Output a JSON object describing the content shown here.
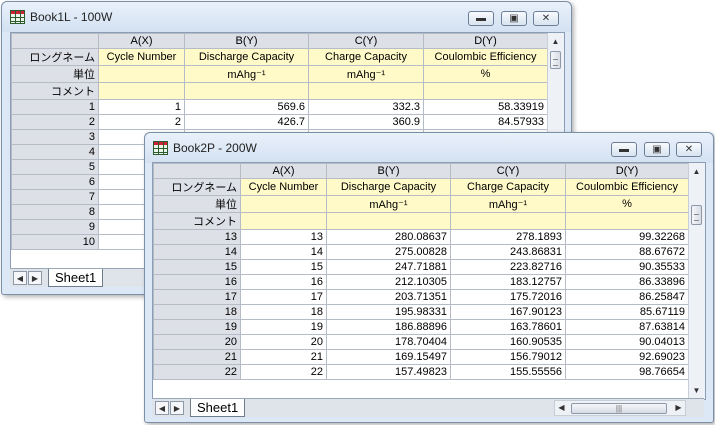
{
  "window1": {
    "title": "Book1L - 100W",
    "columns": [
      "A(X)",
      "B(Y)",
      "C(Y)",
      "D(Y)"
    ],
    "long_name_label": "ロングネーム",
    "units_label": "単位",
    "comment_label": "コメント",
    "long_names": [
      "Cycle Number",
      "Discharge Capacity",
      "Charge Capacity",
      "Coulombic Efficiency"
    ],
    "units": [
      "",
      "mAhg⁻¹",
      "mAhg⁻¹",
      "%"
    ],
    "rows": [
      {
        "idx": "1",
        "a": "1",
        "b": "569.6",
        "c": "332.3",
        "d": "58.33919"
      },
      {
        "idx": "2",
        "a": "2",
        "b": "426.7",
        "c": "360.9",
        "d": "84.57933"
      },
      {
        "idx": "3",
        "a": "",
        "b": "",
        "c": "",
        "d": ""
      },
      {
        "idx": "4",
        "a": "",
        "b": "",
        "c": "",
        "d": ""
      },
      {
        "idx": "5",
        "a": "",
        "b": "",
        "c": "",
        "d": ""
      },
      {
        "idx": "6",
        "a": "",
        "b": "",
        "c": "",
        "d": ""
      },
      {
        "idx": "7",
        "a": "",
        "b": "",
        "c": "",
        "d": ""
      },
      {
        "idx": "8",
        "a": "",
        "b": "",
        "c": "",
        "d": ""
      },
      {
        "idx": "9",
        "a": "",
        "b": "",
        "c": "",
        "d": ""
      },
      {
        "idx": "10",
        "a": "",
        "b": "",
        "c": "",
        "d": ""
      }
    ],
    "sheet_tab": "Sheet1"
  },
  "window2": {
    "title": "Book2P - 200W",
    "columns": [
      "A(X)",
      "B(Y)",
      "C(Y)",
      "D(Y)"
    ],
    "long_name_label": "ロングネーム",
    "units_label": "単位",
    "comment_label": "コメント",
    "long_names": [
      "Cycle Number",
      "Discharge Capacity",
      "Charge Capacity",
      "Coulombic Efficiency"
    ],
    "units": [
      "",
      "mAhg⁻¹",
      "mAhg⁻¹",
      "%"
    ],
    "rows": [
      {
        "idx": "13",
        "a": "13",
        "b": "280.08637",
        "c": "278.1893",
        "d": "99.32268"
      },
      {
        "idx": "14",
        "a": "14",
        "b": "275.00828",
        "c": "243.86831",
        "d": "88.67672"
      },
      {
        "idx": "15",
        "a": "15",
        "b": "247.71881",
        "c": "223.82716",
        "d": "90.35533"
      },
      {
        "idx": "16",
        "a": "16",
        "b": "212.10305",
        "c": "183.12757",
        "d": "86.33896"
      },
      {
        "idx": "17",
        "a": "17",
        "b": "203.71351",
        "c": "175.72016",
        "d": "86.25847"
      },
      {
        "idx": "18",
        "a": "18",
        "b": "195.98331",
        "c": "167.90123",
        "d": "85.67119"
      },
      {
        "idx": "19",
        "a": "19",
        "b": "186.88896",
        "c": "163.78601",
        "d": "87.63814"
      },
      {
        "idx": "20",
        "a": "20",
        "b": "178.70404",
        "c": "160.90535",
        "d": "90.04013"
      },
      {
        "idx": "21",
        "a": "21",
        "b": "169.15497",
        "c": "156.79012",
        "d": "92.69023"
      },
      {
        "idx": "22",
        "a": "22",
        "b": "157.49823",
        "c": "155.55556",
        "d": "98.76654"
      }
    ],
    "sheet_tab": "Sheet1"
  }
}
